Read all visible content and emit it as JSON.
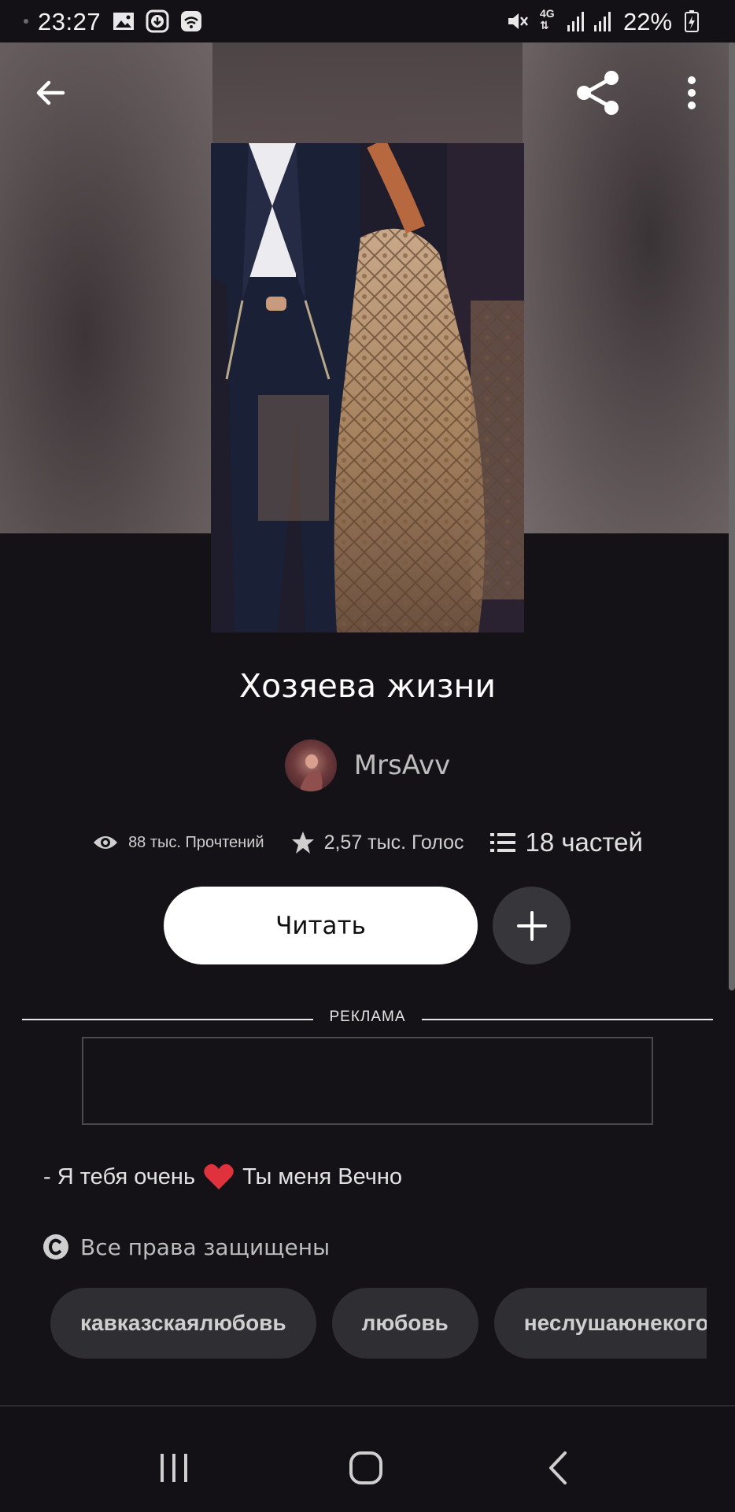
{
  "status_bar": {
    "time": "23:27",
    "network": "4G",
    "battery": "22%",
    "icons": [
      "gallery-icon",
      "download-icon",
      "wifi-icon",
      "mute-icon",
      "signal-icon",
      "signal-icon",
      "battery-icon"
    ]
  },
  "top_bar": {
    "back_icon": "arrow-left-icon",
    "share_icon": "share-icon",
    "menu_icon": "more-vertical-icon"
  },
  "story": {
    "title": "Хозяева жизни",
    "author": "MrsAvv",
    "stats": {
      "reads": "88 тыс. Прочтений",
      "votes": "2,57 тыс. Голос",
      "parts": "18 частей"
    },
    "read_button": "Читать",
    "ad_label": "РЕКЛАМА",
    "description_before": "- Я тебя очень",
    "description_after": "Ты меня Вечно",
    "rights": "Все права защищены",
    "tags": [
      "кавказскаялюбовь",
      "любовь",
      "неслушаюнекого"
    ]
  },
  "colors": {
    "background": "#141216",
    "accent_button": "#ffffff",
    "secondary_button": "#37363a",
    "heart": "#e0323c"
  }
}
